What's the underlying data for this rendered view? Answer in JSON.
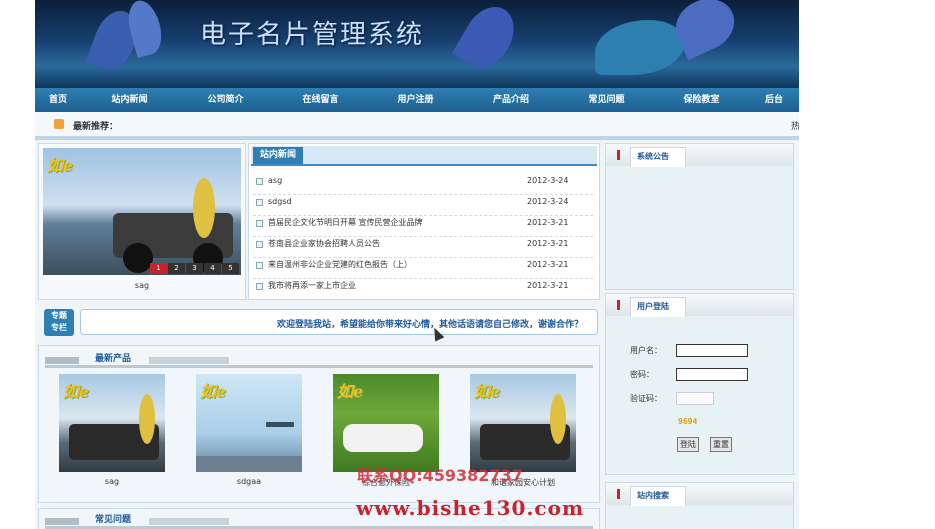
{
  "site": {
    "title": "电子名片管理系统"
  },
  "nav": [
    "首页",
    "站内新闻",
    "公司简介",
    "在线留言",
    "用户注册",
    "产品介绍",
    "常见问题",
    "保险教室",
    "后台"
  ],
  "marquee": {
    "label": "最新推荐：",
    "overflow_text": "热"
  },
  "slideshow": {
    "caption": "sag",
    "pages": [
      "1",
      "2",
      "3",
      "4",
      "5"
    ],
    "active_page": "1"
  },
  "news": {
    "title": "站内新闻",
    "items": [
      {
        "title": "asg",
        "date": "2012-3-24"
      },
      {
        "title": "sdgsd",
        "date": "2012-3-24"
      },
      {
        "title": "首届民企文化节明日开幕 宣传民营企业品牌",
        "date": "2012-3-21"
      },
      {
        "title": "苍南县企业家协会招聘人员公告",
        "date": "2012-3-21"
      },
      {
        "title": "来自温州非公企业党建的红色报告（上）",
        "date": "2012-3-21"
      },
      {
        "title": "我市将再添一家上市企业",
        "date": "2012-3-21"
      }
    ]
  },
  "welcome": {
    "tag_line1": "专题",
    "tag_line2": "专栏",
    "message": "欢迎登陆我站，希望能给你带来好心情，其他话语请您自己修改，谢谢合作？"
  },
  "products": {
    "title": "最新产品",
    "items": [
      {
        "caption": "sag",
        "image": "jeep-photo"
      },
      {
        "caption": "sdgaa",
        "image": "city-plane-photo"
      },
      {
        "caption": "综合意外保险",
        "image": "grass-man-photo"
      },
      {
        "caption": "和谐家园安心计划",
        "image": "jeep-photo"
      }
    ]
  },
  "faq": {
    "title": "常见问题"
  },
  "sidebar": {
    "notice_title": "系统公告",
    "login": {
      "title": "用户登陆",
      "username_label": "用户名：",
      "password_label": "密码：",
      "captcha_label": "验证码：",
      "captcha_code": "9694",
      "login_button": "登陆",
      "reset_button": "重置"
    },
    "search_title": "站内搜索"
  },
  "watermark": {
    "qq": "联系QQ:459382737",
    "url": "www.bishe130.com"
  },
  "colors": {
    "nav_bg": "#1b5f8f",
    "accent_red": "#c8232c",
    "link_blue": "#1f5a9a"
  }
}
